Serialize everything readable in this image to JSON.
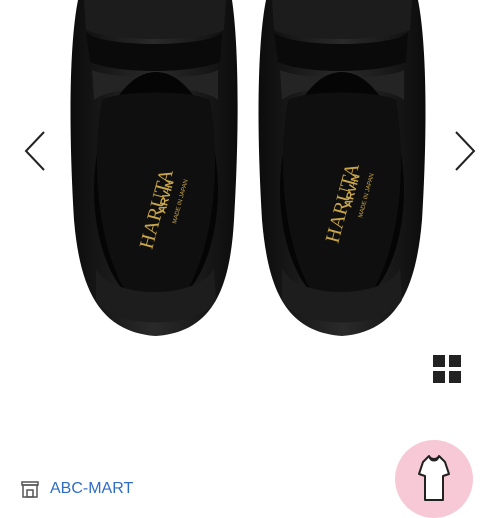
{
  "gallery": {
    "brand_text": "HARUTA",
    "sub_brand_text": "ARVIN",
    "origin_text": "MADE IN JAPAN",
    "prev_icon": "chevron-left-icon",
    "next_icon": "chevron-right-icon",
    "grid_icon": "grid-view-icon"
  },
  "shop": {
    "icon": "storefront-icon",
    "name": "ABC-MART"
  },
  "avatar": {
    "icon": "dress-icon"
  },
  "colors": {
    "shoe": "#141414",
    "insole_gold": "#c9a64a",
    "link": "#2f6cc4",
    "avatar_bg": "#f7c9d6"
  }
}
